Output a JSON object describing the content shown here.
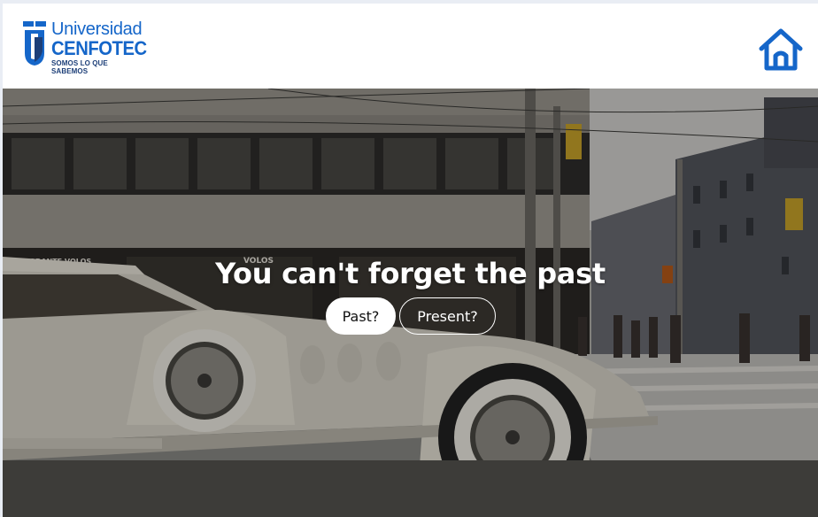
{
  "header": {
    "logo": {
      "line1": "Universidad",
      "line2": "CENFOTEC",
      "tagline": "SOMOS LO QUE SABEMOS"
    },
    "home_icon": "home-icon"
  },
  "hero": {
    "title": "You can't forget the past",
    "buttons": {
      "past_label": "Past?",
      "present_label": "Present?"
    },
    "storefront_sign_1": "RISTORANTE VOLOS",
    "storefront_sign_2": "VOLOS"
  },
  "colors": {
    "brand_blue": "#1566c9",
    "brand_dark": "#1d3f78",
    "hero_text": "#ffffff"
  }
}
